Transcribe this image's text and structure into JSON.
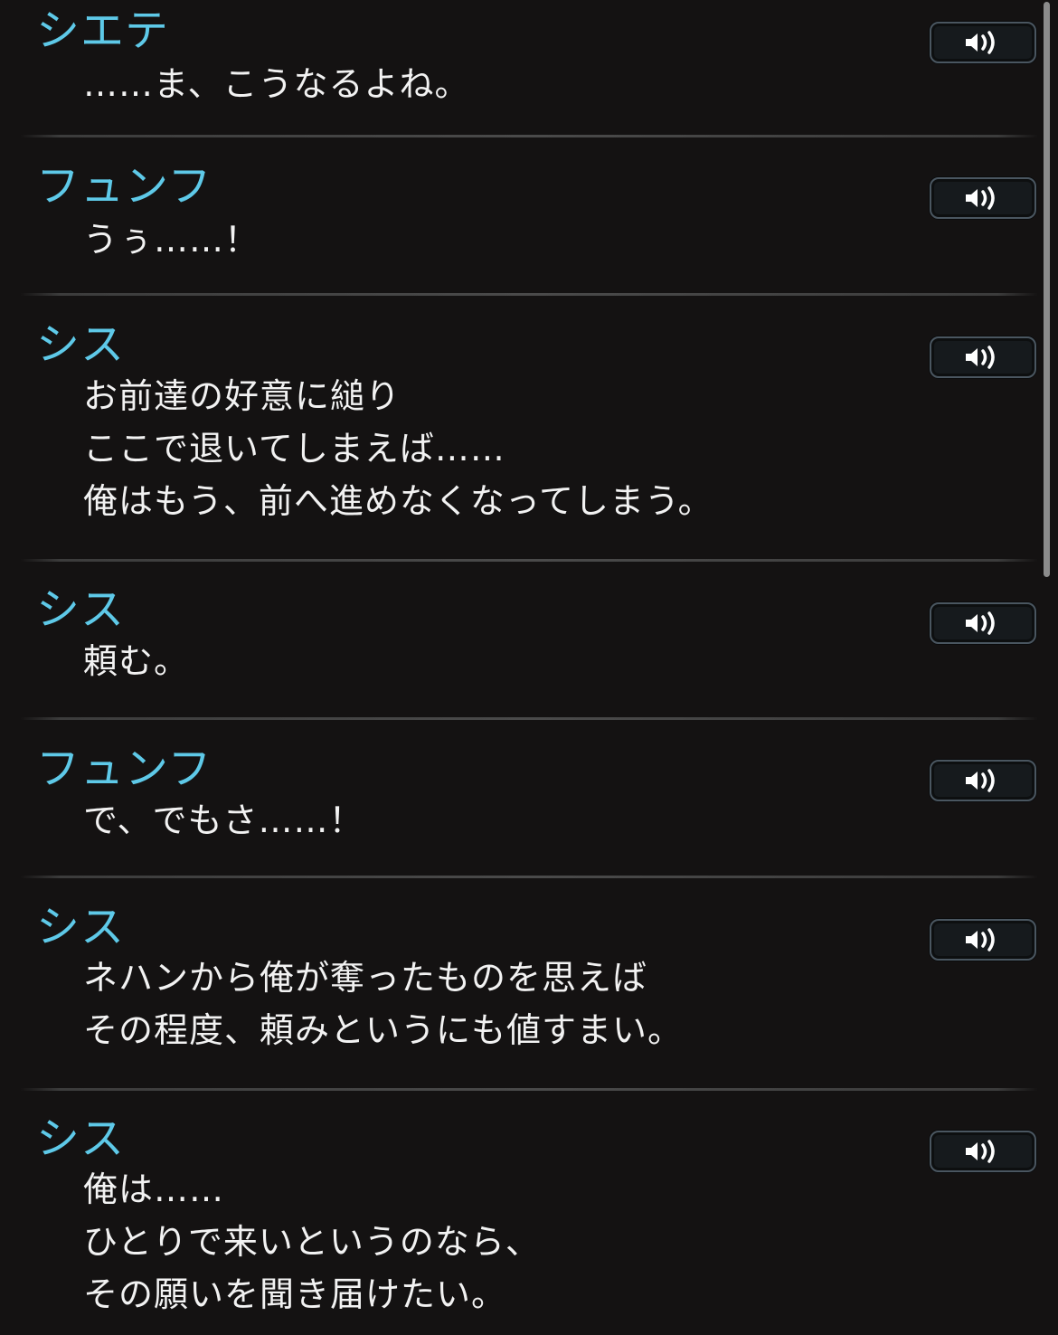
{
  "icons": {
    "voice_play": "speaker-volume-icon"
  },
  "colors": {
    "background": "#141212",
    "speaker_name": "#5ec9e8",
    "dialogue_text": "#f2f2f2",
    "divider": "#4a4a4a",
    "button_border": "#4a5660"
  },
  "log": [
    {
      "speaker": "シエテ",
      "lines": [
        "……ま、こうなるよね。"
      ]
    },
    {
      "speaker": "フュンフ",
      "lines": [
        "うぅ……！"
      ]
    },
    {
      "speaker": "シス",
      "lines": [
        "お前達の好意に縋り",
        "ここで退いてしまえば……",
        "俺はもう、前へ進めなくなってしまう。"
      ]
    },
    {
      "speaker": "シス",
      "lines": [
        "頼む。"
      ]
    },
    {
      "speaker": "フュンフ",
      "lines": [
        "で、でもさ……！"
      ]
    },
    {
      "speaker": "シス",
      "lines": [
        "ネハンから俺が奪ったものを思えば",
        "その程度、頼みというにも値すまい。"
      ]
    },
    {
      "speaker": "シス",
      "lines": [
        "俺は……",
        "ひとりで来いというのなら、",
        "その願いを聞き届けたい。"
      ]
    }
  ]
}
